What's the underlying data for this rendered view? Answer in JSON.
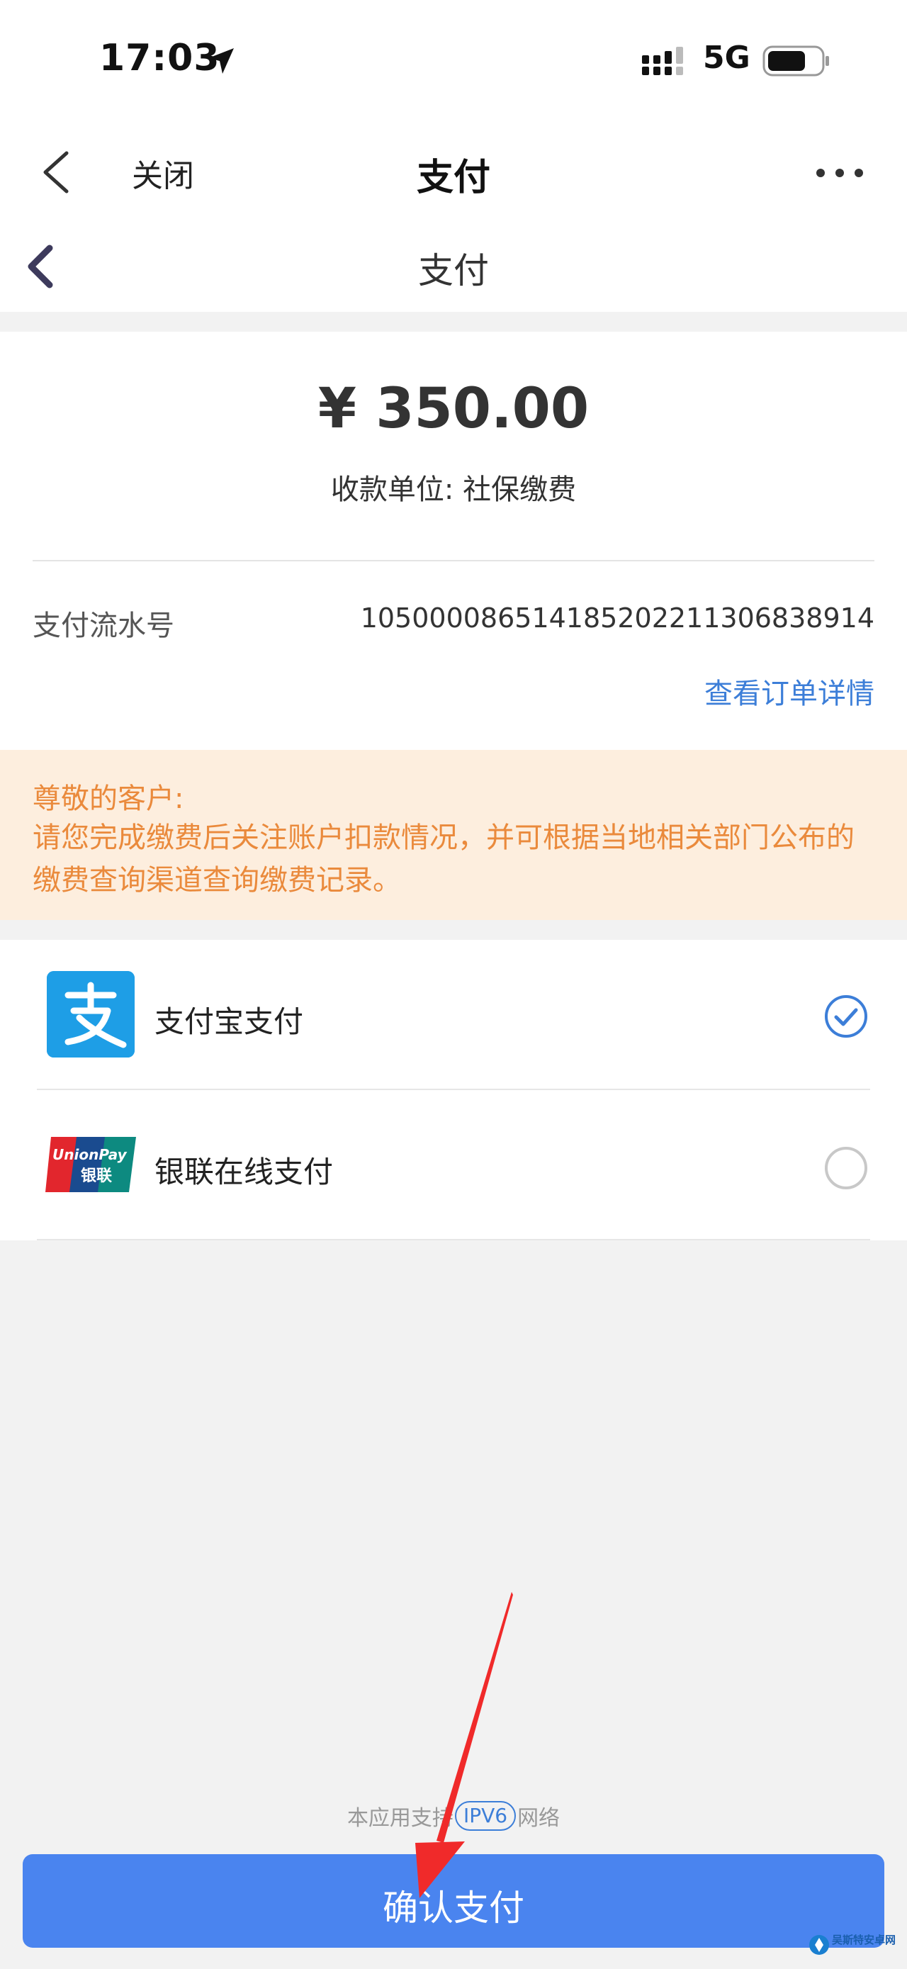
{
  "status_bar": {
    "time": "17:03",
    "network": "5G",
    "icons": [
      "location-arrow-icon",
      "signal-bars-icon",
      "battery-icon"
    ]
  },
  "nav": {
    "close_label": "关闭",
    "title": "支付",
    "icons": [
      "back-chevron-icon",
      "more-dots-icon"
    ]
  },
  "inner_header": {
    "title": "支付"
  },
  "payment": {
    "amount": "¥ 350.00",
    "payee_label": "收款单位: ",
    "payee_name": "社保缴费",
    "serial_label": "支付流水号",
    "serial_value": "105000086514185202211306838914",
    "order_detail_link": "查看订单详情"
  },
  "notice": {
    "greeting": "尊敬的客户:",
    "body": "请您完成缴费后关注账户扣款情况，并可根据当地相关部门公布的缴费查询渠道查询缴费记录。"
  },
  "methods": [
    {
      "label": "支付宝支付",
      "icon": "alipay-logo-icon",
      "selected": true
    },
    {
      "label": "银联在线支付",
      "icon": "unionpay-logo-icon",
      "selected": false
    }
  ],
  "unionpay_logo_text": {
    "top": "UnionPay",
    "bottom": "银联"
  },
  "footer": {
    "ipv6_prefix": "本应用支持",
    "ipv6_badge": "IPV6",
    "ipv6_suffix": "网络",
    "confirm_label": "确认支付"
  },
  "colors": {
    "primary_button": "#4a84ef",
    "link": "#3c7ed8",
    "notice_text": "#ea8a3c",
    "notice_bg": "#fdeede",
    "alipay_blue": "#1e9ee6",
    "annotation_arrow": "#f02a2a"
  },
  "watermark_text": "吴斯特安卓网"
}
